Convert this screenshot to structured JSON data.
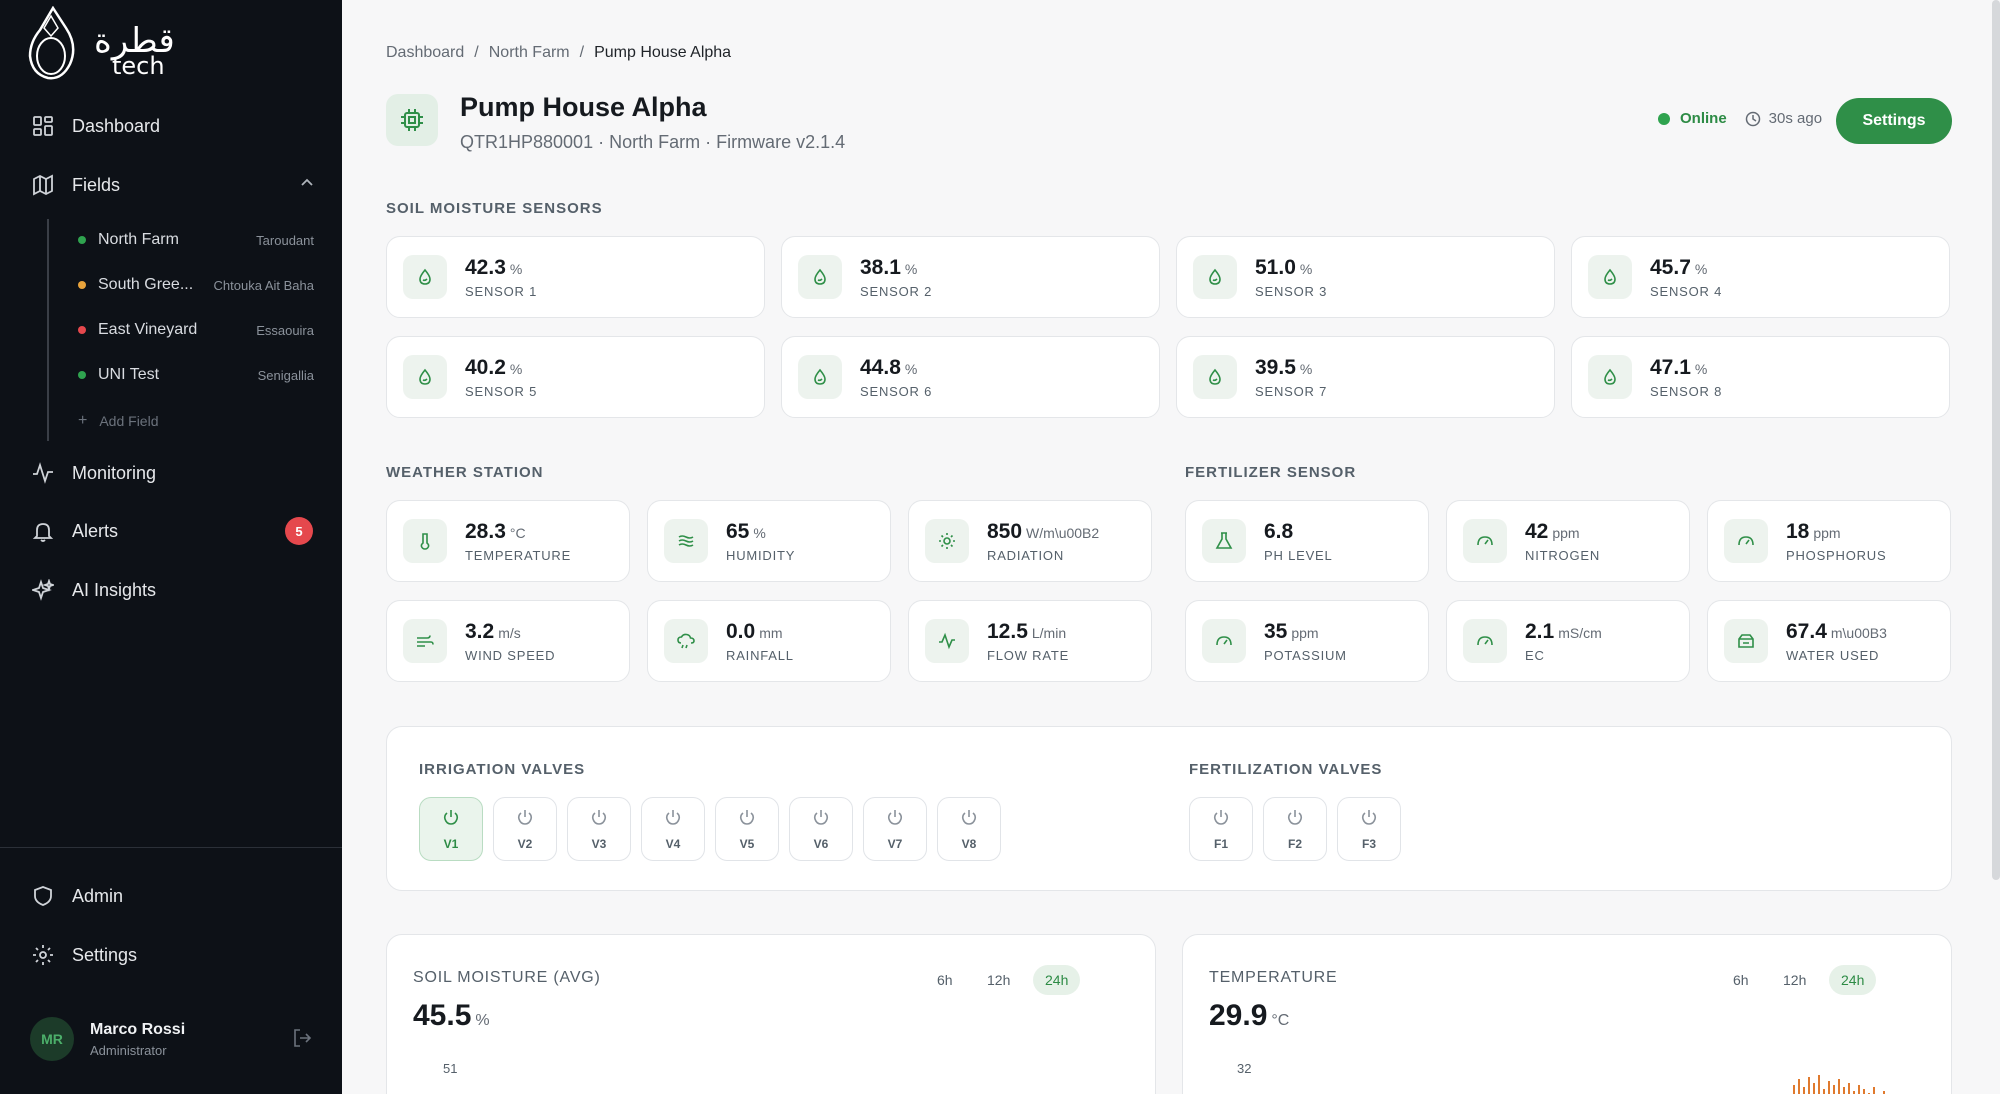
{
  "brand": {
    "logo_text": "قطرة tech",
    "colors": {
      "sidebar_bg": "#0d1117",
      "accent": "#2f8f48"
    }
  },
  "sidebar": {
    "nav": {
      "dashboard": "Dashboard",
      "fields": "Fields",
      "monitoring": "Monitoring",
      "alerts": "Alerts",
      "alerts_count": "5",
      "ai_insights": "AI Insights",
      "admin": "Admin",
      "settings": "Settings"
    },
    "fields": [
      {
        "name": "North Farm",
        "location": "Taroudant",
        "status_color": "#2fa34f"
      },
      {
        "name": "South Gree...",
        "location": "Chtouka Ait Baha",
        "status_color": "#e8a33b"
      },
      {
        "name": "East Vineyard",
        "location": "Essaouira",
        "status_color": "#e5484d"
      },
      {
        "name": "UNI Test",
        "location": "Senigallia",
        "status_color": "#2fa34f"
      }
    ],
    "add_field": "Add Field",
    "user": {
      "initials": "MR",
      "name": "Marco Rossi",
      "role": "Administrator"
    }
  },
  "breadcrumb": [
    "Dashboard",
    "North Farm",
    "Pump House Alpha"
  ],
  "device": {
    "title": "Pump House Alpha",
    "subtitle": "QTR1HP880001 · North Farm · Firmware v2.1.4",
    "status": "Online",
    "last_seen": "30s ago",
    "settings_label": "Settings"
  },
  "soil": {
    "title": "SOIL MOISTURE SENSORS",
    "sensors": [
      {
        "value": "42.3",
        "unit": "%",
        "label": "SENSOR 1"
      },
      {
        "value": "38.1",
        "unit": "%",
        "label": "SENSOR 2"
      },
      {
        "value": "51.0",
        "unit": "%",
        "label": "SENSOR 3"
      },
      {
        "value": "45.7",
        "unit": "%",
        "label": "SENSOR 4"
      },
      {
        "value": "40.2",
        "unit": "%",
        "label": "SENSOR 5"
      },
      {
        "value": "44.8",
        "unit": "%",
        "label": "SENSOR 6"
      },
      {
        "value": "39.5",
        "unit": "%",
        "label": "SENSOR 7"
      },
      {
        "value": "47.1",
        "unit": "%",
        "label": "SENSOR 8"
      }
    ]
  },
  "weather": {
    "title": "WEATHER STATION",
    "items": [
      {
        "value": "28.3",
        "unit": "°C",
        "label": "TEMPERATURE",
        "icon": "thermometer-icon"
      },
      {
        "value": "65",
        "unit": "%",
        "label": "HUMIDITY",
        "icon": "waves-icon"
      },
      {
        "value": "850",
        "unit": "W/m\\u00B2",
        "label": "RADIATION",
        "icon": "sun-icon"
      },
      {
        "value": "3.2",
        "unit": "m/s",
        "label": "WIND SPEED",
        "icon": "wind-icon"
      },
      {
        "value": "0.0",
        "unit": "mm",
        "label": "RAINFALL",
        "icon": "cloud-rain-icon"
      },
      {
        "value": "12.5",
        "unit": "L/min",
        "label": "FLOW RATE",
        "icon": "activity-icon"
      }
    ]
  },
  "fertilizer": {
    "title": "FERTILIZER SENSOR",
    "items": [
      {
        "value": "6.8",
        "unit": "",
        "label": "PH LEVEL",
        "icon": "flask-icon"
      },
      {
        "value": "42",
        "unit": "ppm",
        "label": "NITROGEN",
        "icon": "gauge-icon"
      },
      {
        "value": "18",
        "unit": "ppm",
        "label": "PHOSPHORUS",
        "icon": "gauge-icon"
      },
      {
        "value": "35",
        "unit": "ppm",
        "label": "POTASSIUM",
        "icon": "gauge-icon"
      },
      {
        "value": "2.1",
        "unit": "mS/cm",
        "label": "EC",
        "icon": "gauge-icon"
      },
      {
        "value": "67.4",
        "unit": "m\\u00B3",
        "label": "WATER USED",
        "icon": "container-icon"
      }
    ]
  },
  "valves": {
    "irrigation_title": "IRRIGATION VALVES",
    "irrigation": [
      {
        "label": "V1",
        "on": true
      },
      {
        "label": "V2",
        "on": false
      },
      {
        "label": "V3",
        "on": false
      },
      {
        "label": "V4",
        "on": false
      },
      {
        "label": "V5",
        "on": false
      },
      {
        "label": "V6",
        "on": false
      },
      {
        "label": "V7",
        "on": false
      },
      {
        "label": "V8",
        "on": false
      }
    ],
    "fertilization_title": "FERTILIZATION VALVES",
    "fertilization": [
      {
        "label": "F1",
        "on": false
      },
      {
        "label": "F2",
        "on": false
      },
      {
        "label": "F3",
        "on": false
      }
    ]
  },
  "charts": {
    "soil": {
      "title": "SOIL MOISTURE (AVG)",
      "value": "45.5",
      "unit": "%",
      "ranges": [
        "6h",
        "12h",
        "24h"
      ],
      "selected": "24h",
      "y_top_tick": "51"
    },
    "temperature": {
      "title": "TEMPERATURE",
      "value": "29.9",
      "unit": "°C",
      "ranges": [
        "6h",
        "12h",
        "24h"
      ],
      "selected": "24h",
      "y_top_tick": "32"
    }
  }
}
